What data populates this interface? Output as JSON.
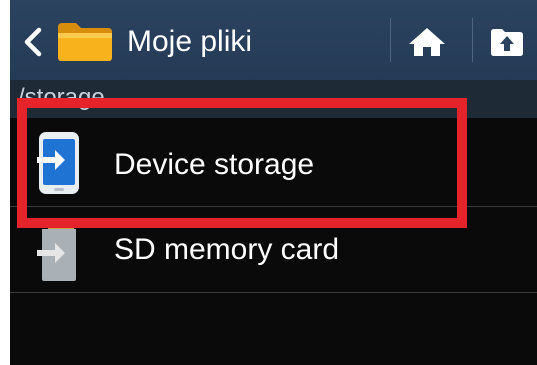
{
  "actionbar": {
    "title": "Moje pliki",
    "back_icon": "chevron-left-icon",
    "app_icon": "folder-icon",
    "home_icon": "home-icon",
    "up_icon": "folder-up-icon"
  },
  "path": {
    "text": "/storage"
  },
  "list": {
    "items": [
      {
        "label": "Device storage",
        "icon": "device-storage-icon"
      },
      {
        "label": "SD memory card",
        "icon": "sd-card-icon"
      }
    ]
  },
  "colors": {
    "actionbar_bg": "#2c4360",
    "screen_bg": "#0a0a0a",
    "highlight": "#e5232a",
    "folder_yellow": "#f7b21c",
    "device_blue": "#1f73d3"
  }
}
